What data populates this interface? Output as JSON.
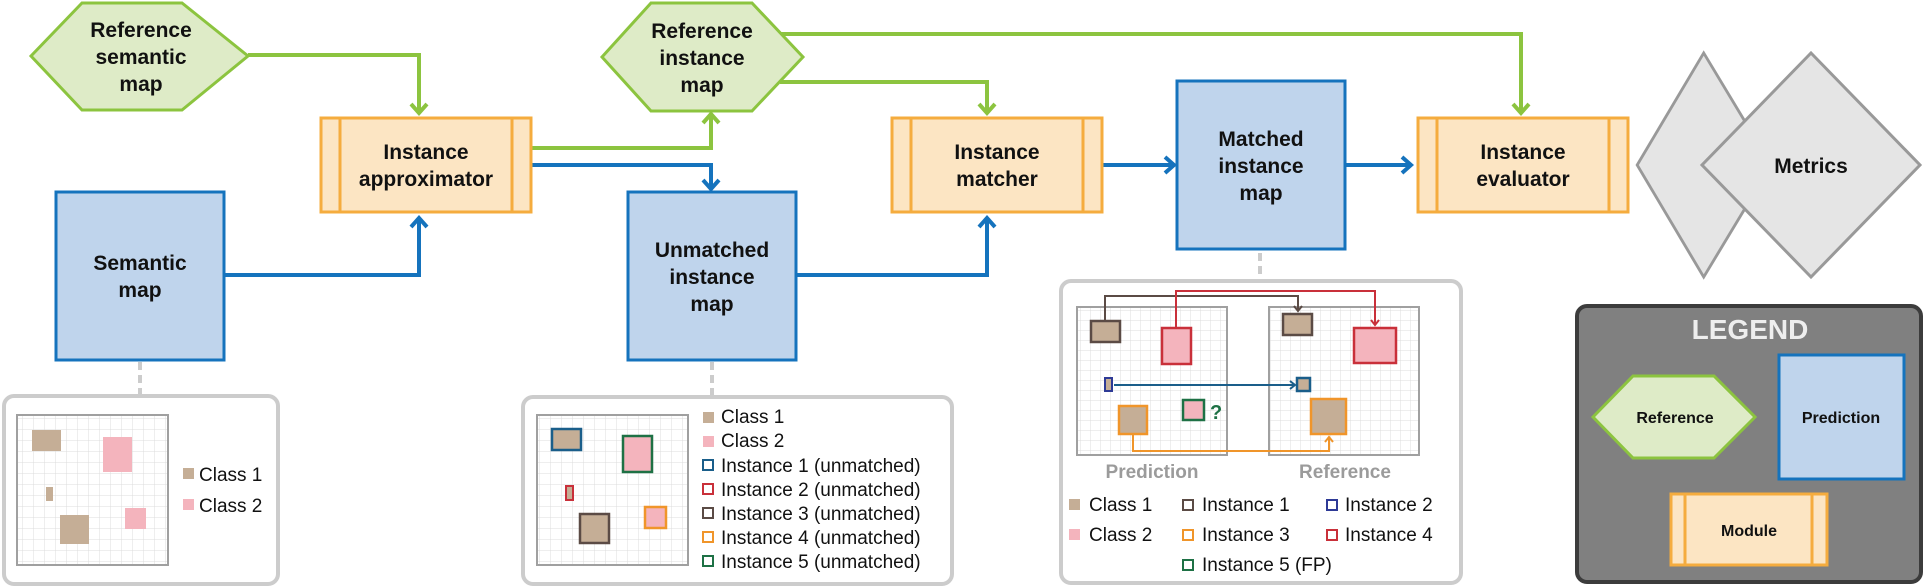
{
  "colors": {
    "reference_fill": "#deebc7",
    "reference_stroke": "#8cc43f",
    "prediction_fill": "#bfd4ec",
    "prediction_stroke": "#1573bd",
    "module_fill": "#fce5c3",
    "module_stroke": "#f5ac3e",
    "metrics_fill": "#e5e5e5",
    "metrics_stroke": "#999999",
    "class1": "#c5ae96",
    "class2": "#f4b4bd",
    "instance_blue": "#1a5e8a",
    "instance_navy": "#2e3a96",
    "instance_red": "#c9303a",
    "instance_brown": "#5b4b45",
    "instance_orange": "#f0952a",
    "instance_green": "#1e7145",
    "legend_bg": "#808080",
    "panel_border": "#cccccc",
    "caption_gray": "#9b9b9b"
  },
  "nodes": {
    "ref_semantic": {
      "lines": [
        "Reference",
        "semantic",
        "map"
      ]
    },
    "semantic_map": {
      "lines": [
        "Semantic",
        "map"
      ]
    },
    "approximator": {
      "lines": [
        "Instance",
        "approximator"
      ]
    },
    "ref_instance": {
      "lines": [
        "Reference",
        "instance",
        "map"
      ]
    },
    "unmatched": {
      "lines": [
        "Unmatched",
        "instance",
        "map"
      ]
    },
    "matcher": {
      "lines": [
        "Instance",
        "matcher"
      ]
    },
    "matched": {
      "lines": [
        "Matched",
        "instance",
        "map"
      ]
    },
    "evaluator": {
      "lines": [
        "Instance",
        "evaluator"
      ]
    },
    "metrics": {
      "lines": [
        "Metrics"
      ]
    }
  },
  "panel_semantic": {
    "legend": [
      "Class 1",
      "Class 2"
    ]
  },
  "panel_unmatched": {
    "legend": [
      "Class 1",
      "Class 2",
      "Instance 1 (unmatched)",
      "Instance 2 (unmatched)",
      "Instance 3 (unmatched)",
      "Instance 4 (unmatched)",
      "Instance 5 (unmatched)"
    ]
  },
  "panel_matched": {
    "caption_left": "Prediction",
    "caption_right": "Reference",
    "question_mark": "?",
    "legend": {
      "class1": "Class 1",
      "class2": "Class 2",
      "inst1": "Instance 1",
      "inst2": "Instance 2",
      "inst3": "Instance 3",
      "inst4": "Instance 4",
      "inst5": "Instance 5 (FP)"
    }
  },
  "legend": {
    "title": "LEGEND",
    "reference": "Reference",
    "prediction": "Prediction",
    "module": "Module"
  }
}
